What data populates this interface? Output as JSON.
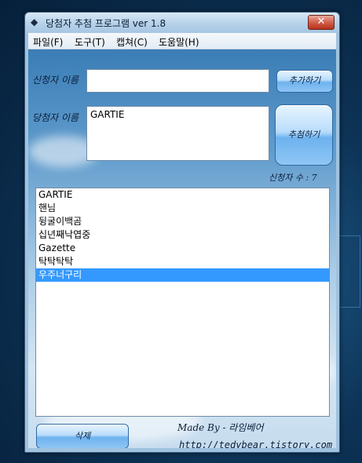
{
  "window": {
    "title": "당첨자 추첨 프로그램 ver 1.8",
    "close_label": "✕"
  },
  "menu": [
    {
      "label": "파일(F)"
    },
    {
      "label": "도구(T)"
    },
    {
      "label": "캡쳐(C)"
    },
    {
      "label": "도움말(H)"
    }
  ],
  "applicant": {
    "label": "신청자 이름",
    "value": "",
    "add_button": "추가하기"
  },
  "winner": {
    "label": "당첨자 이름",
    "value": "GARTIE",
    "draw_button": "추첨하기"
  },
  "count": {
    "text": "신청자 수 : 7"
  },
  "list": {
    "items": [
      "GARTIE",
      "핸님",
      "뒹굴이백곰",
      "십년째낙엽중",
      "Gazette",
      "탁탁탁탁",
      "우주너구리"
    ],
    "selected_index": 6
  },
  "delete_button": "삭제",
  "footer": {
    "made_by": "Made By - 라임베어",
    "url": "http://tedybear.tistory.com"
  }
}
